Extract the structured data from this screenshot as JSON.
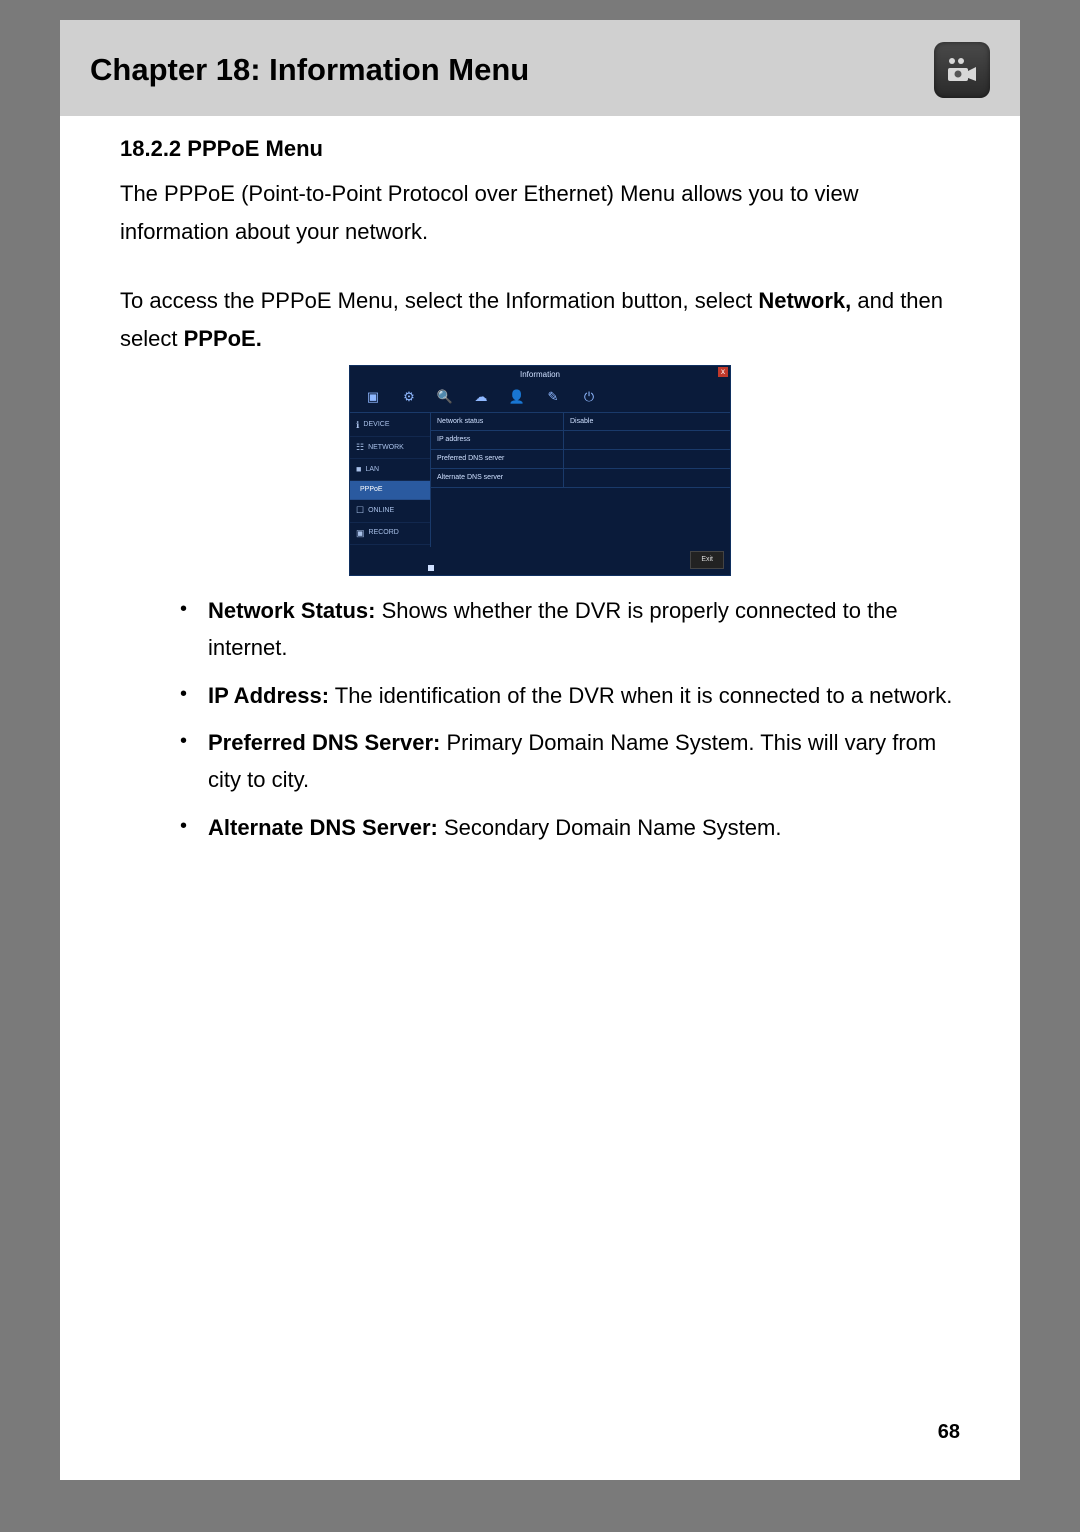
{
  "header": {
    "chapter_title": "Chapter 18: Information Menu",
    "icon_name": "dvr-camera-icon"
  },
  "section": {
    "heading": "18.2.2 PPPoE Menu",
    "intro": "The PPPoE (Point-to-Point Protocol over Ethernet) Menu allows you to view information about your network.",
    "access_pre": "To access the PPPoE Menu, select the Information button, select ",
    "access_bold1": "Network,",
    "access_mid": " and then select ",
    "access_bold2": "PPPoE."
  },
  "screenshot": {
    "title": "Information",
    "close": "x",
    "toolbar_icons": [
      "camera-icon",
      "gear-icon",
      "search-icon",
      "cloud-icon",
      "user-icon",
      "pen-icon",
      "power-icon"
    ],
    "sidebar": [
      {
        "icon": "ℹ",
        "label": "DEVICE",
        "active": false
      },
      {
        "icon": "☷",
        "label": "NETWORK",
        "active": false
      },
      {
        "icon": "■",
        "label": "LAN",
        "active": false
      },
      {
        "icon": "",
        "label": "PPPoE",
        "active": true
      },
      {
        "icon": "☐",
        "label": "ONLINE",
        "active": false
      },
      {
        "icon": "▣",
        "label": "RECORD",
        "active": false
      }
    ],
    "rows": [
      {
        "k": "Network status",
        "v": "Disable"
      },
      {
        "k": "IP address",
        "v": ""
      },
      {
        "k": "Preferred DNS server",
        "v": ""
      },
      {
        "k": "Alternate DNS server",
        "v": ""
      }
    ],
    "exit_label": "Exit"
  },
  "bullets": [
    {
      "term": "Network Status:",
      "desc": " Shows whether the DVR is properly connected to the internet."
    },
    {
      "term": "IP Address:",
      "desc": " The identification of the DVR when it is connected to a network."
    },
    {
      "term": "Preferred DNS Server:",
      "desc": " Primary Domain Name System. This will vary from city to city."
    },
    {
      "term": "Alternate DNS Server:",
      "desc": " Secondary Domain Name System."
    }
  ],
  "page_number": "68"
}
